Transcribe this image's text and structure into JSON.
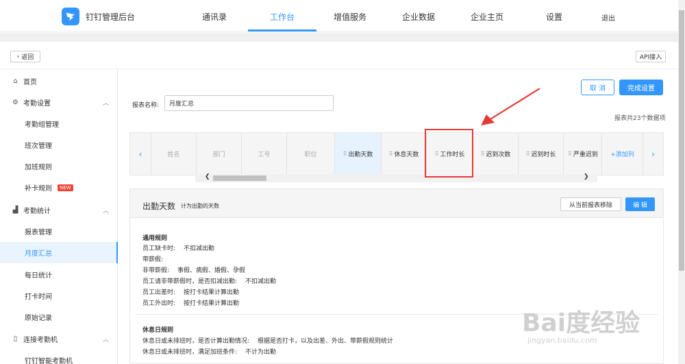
{
  "header": {
    "brand": "钉钉管理后台",
    "nav": [
      "通讯录",
      "工作台",
      "增值服务",
      "企业数据",
      "企业主页",
      "设置"
    ],
    "active_nav": "工作台",
    "logout": "退出"
  },
  "subbar": {
    "back": "返回",
    "api": "API接入"
  },
  "sidebar": {
    "items": [
      {
        "label": "首页",
        "icon": "home-icon"
      },
      {
        "label": "考勤设置",
        "icon": "settings-icon"
      },
      {
        "label": "考勤组管理"
      },
      {
        "label": "班次管理"
      },
      {
        "label": "加班规则"
      },
      {
        "label": "补卡规则",
        "badge": "NEW"
      },
      {
        "label": "考勤统计",
        "icon": "bar-chart-icon"
      },
      {
        "label": "报表管理"
      },
      {
        "label": "月度汇总",
        "active": true
      },
      {
        "label": "每日统计"
      },
      {
        "label": "打卡时间"
      },
      {
        "label": "原始记录"
      },
      {
        "label": "连接考勤机",
        "icon": "device-icon"
      },
      {
        "label": "钉钉智能考勤机"
      }
    ]
  },
  "toolbar": {
    "cancel": "取 消",
    "done": "完成设置"
  },
  "report": {
    "name_label": "报表名称:",
    "name_value": "月度汇总",
    "count_text": "报表共23个数据项"
  },
  "columns": [
    {
      "label": "姓名",
      "state": "dim"
    },
    {
      "label": "部门",
      "state": "dim"
    },
    {
      "label": "工号",
      "state": "dim"
    },
    {
      "label": "职位",
      "state": "dim"
    },
    {
      "label": "出勤天数",
      "state": "highlighted"
    },
    {
      "label": "休息天数",
      "state": "normal"
    },
    {
      "label": "工作时长",
      "state": "normal"
    },
    {
      "label": "迟到次数",
      "state": "normal"
    },
    {
      "label": "迟到时长",
      "state": "normal"
    },
    {
      "label": "严重迟到",
      "state": "normal"
    },
    {
      "label": "+添加列",
      "state": "add"
    }
  ],
  "detail": {
    "title": "出勤天数",
    "desc": "计为出勤的天数",
    "remove_btn": "从当前报表移除",
    "edit_btn": "编 辑",
    "sections": [
      {
        "title": "通用规则",
        "lines": [
          {
            "k": "员工缺卡时:",
            "v": "不扣减出勤"
          },
          {
            "k": "带薪假:",
            "v": ""
          },
          {
            "k": "非带薪假:",
            "v": "事假、病假、婚假、孕假"
          },
          {
            "k": "员工请非带薪假时，是否扣减出勤:",
            "v": "不扣减出勤"
          },
          {
            "k": "员工出差时:",
            "v": "按打卡结果计算出勤"
          },
          {
            "k": "员工外出时:",
            "v": "按打卡结果计算出勤"
          }
        ]
      },
      {
        "title": "休息日规则",
        "lines": [
          {
            "k": "休息日或未排班时，是否计算出勤情况:",
            "v": "根据是否打卡，以及出差、外出、带薪假规则统计"
          },
          {
            "k": "休息日或未排班时，满足加班条件:",
            "v": "不计为出勤"
          }
        ]
      }
    ]
  },
  "watermark": {
    "big": "Bai度经验",
    "small": "jingyan.baidu.com"
  }
}
